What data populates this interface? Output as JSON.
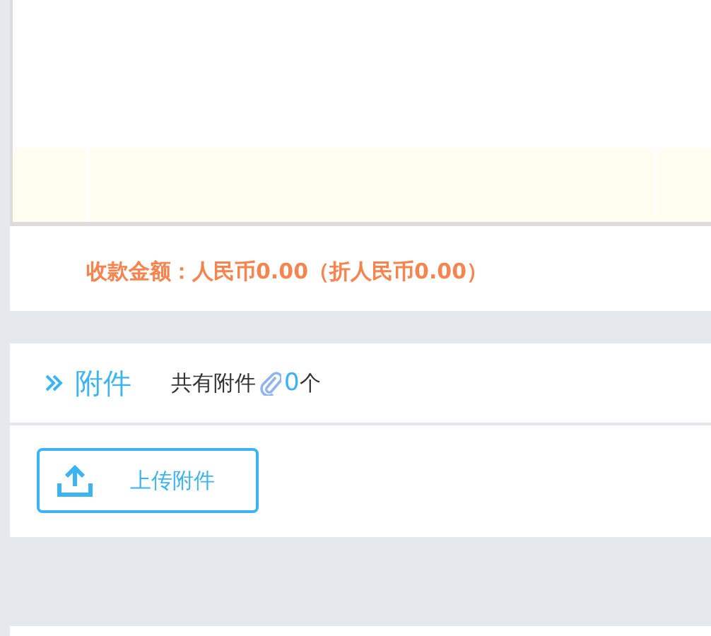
{
  "summary": {
    "total": "收款金额：人民币0.00（折人民币0.00）"
  },
  "attachments": {
    "title": "附件",
    "count_label": "共有附件",
    "count": "0",
    "count_unit": "个",
    "upload_button": "上传附件"
  }
}
